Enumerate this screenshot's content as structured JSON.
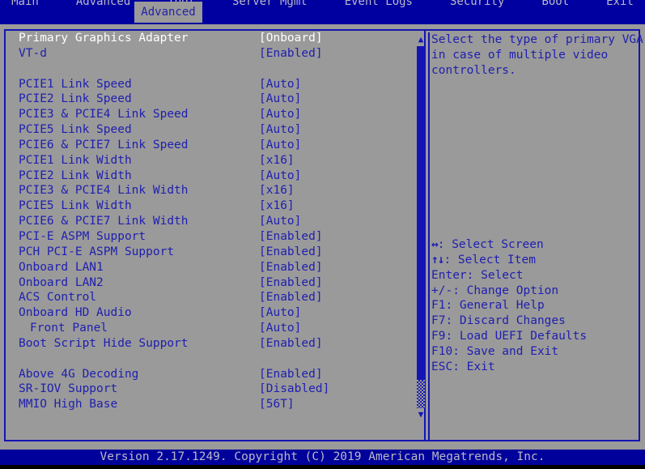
{
  "colors": {
    "background": "#9a9a9a",
    "border": "#1414b4",
    "text": "#2020b0",
    "selected_text": "#ffffff",
    "menubar": "#0000a0",
    "footer": "#00009b",
    "footer_text": "#b9b9c8"
  },
  "menubar": {
    "items": [
      "Main",
      "Advanced",
      "Tool",
      "Server Mgmt",
      "Event Logs",
      "Security",
      "Boot",
      "Exit"
    ],
    "active_tab": "Advanced"
  },
  "settings": {
    "rows": [
      {
        "label": "Primary Graphics Adapter",
        "value": "[Onboard]",
        "selected": true,
        "indent": false,
        "spacer": false
      },
      {
        "label": "VT-d",
        "value": "[Enabled]",
        "selected": false,
        "indent": false,
        "spacer": false
      },
      {
        "label": "",
        "value": "",
        "selected": false,
        "indent": false,
        "spacer": true
      },
      {
        "label": "PCIE1 Link Speed",
        "value": "[Auto]",
        "selected": false,
        "indent": false,
        "spacer": false
      },
      {
        "label": "PCIE2 Link Speed",
        "value": "[Auto]",
        "selected": false,
        "indent": false,
        "spacer": false
      },
      {
        "label": "PCIE3 & PCIE4 Link Speed",
        "value": "[Auto]",
        "selected": false,
        "indent": false,
        "spacer": false
      },
      {
        "label": "PCIE5 Link Speed",
        "value": "[Auto]",
        "selected": false,
        "indent": false,
        "spacer": false
      },
      {
        "label": "PCIE6 & PCIE7 Link Speed",
        "value": "[Auto]",
        "selected": false,
        "indent": false,
        "spacer": false
      },
      {
        "label": "PCIE1 Link Width",
        "value": "[x16]",
        "selected": false,
        "indent": false,
        "spacer": false
      },
      {
        "label": "PCIE2 Link Width",
        "value": "[Auto]",
        "selected": false,
        "indent": false,
        "spacer": false
      },
      {
        "label": "PCIE3 & PCIE4 Link Width",
        "value": "[x16]",
        "selected": false,
        "indent": false,
        "spacer": false
      },
      {
        "label": "PCIE5 Link Width",
        "value": "[x16]",
        "selected": false,
        "indent": false,
        "spacer": false
      },
      {
        "label": "PCIE6 & PCIE7 Link Width",
        "value": "[Auto]",
        "selected": false,
        "indent": false,
        "spacer": false
      },
      {
        "label": "PCI-E ASPM Support",
        "value": "[Enabled]",
        "selected": false,
        "indent": false,
        "spacer": false
      },
      {
        "label": "PCH PCI-E ASPM Support",
        "value": "[Enabled]",
        "selected": false,
        "indent": false,
        "spacer": false
      },
      {
        "label": "Onboard LAN1",
        "value": "[Enabled]",
        "selected": false,
        "indent": false,
        "spacer": false
      },
      {
        "label": "Onboard LAN2",
        "value": "[Enabled]",
        "selected": false,
        "indent": false,
        "spacer": false
      },
      {
        "label": "ACS Control",
        "value": "[Enabled]",
        "selected": false,
        "indent": false,
        "spacer": false
      },
      {
        "label": "Onboard HD Audio",
        "value": "[Auto]",
        "selected": false,
        "indent": false,
        "spacer": false
      },
      {
        "label": "Front Panel",
        "value": "[Auto]",
        "selected": false,
        "indent": true,
        "spacer": false
      },
      {
        "label": "Boot Script Hide Support",
        "value": "[Enabled]",
        "selected": false,
        "indent": false,
        "spacer": false
      },
      {
        "label": "",
        "value": "",
        "selected": false,
        "indent": false,
        "spacer": true
      },
      {
        "label": "Above 4G Decoding",
        "value": "[Enabled]",
        "selected": false,
        "indent": false,
        "spacer": false
      },
      {
        "label": "SR-IOV Support",
        "value": "[Disabled]",
        "selected": false,
        "indent": false,
        "spacer": false
      },
      {
        "label": "MMIO High Base",
        "value": "[56T]",
        "selected": false,
        "indent": false,
        "spacer": false
      }
    ]
  },
  "scrollbar": {
    "up_arrow": "▲",
    "down_arrow": "▼"
  },
  "help": {
    "description_lines": [
      "Select the type of primary VGA",
      "in case of multiple video",
      "controllers."
    ],
    "keys": [
      {
        "glyph": "↔",
        "text": ": Select Screen"
      },
      {
        "glyph": "↑↓",
        "text": ": Select Item"
      },
      {
        "glyph": "",
        "text": "Enter: Select"
      },
      {
        "glyph": "",
        "text": "+/-: Change Option"
      },
      {
        "glyph": "",
        "text": "F1: General Help"
      },
      {
        "glyph": "",
        "text": "F7: Discard Changes"
      },
      {
        "glyph": "",
        "text": "F9: Load UEFI Defaults"
      },
      {
        "glyph": "",
        "text": "F10: Save and Exit"
      },
      {
        "glyph": "",
        "text": "ESC: Exit"
      }
    ]
  },
  "footer": {
    "text": "Version 2.17.1249. Copyright (C) 2019 American Megatrends, Inc."
  }
}
